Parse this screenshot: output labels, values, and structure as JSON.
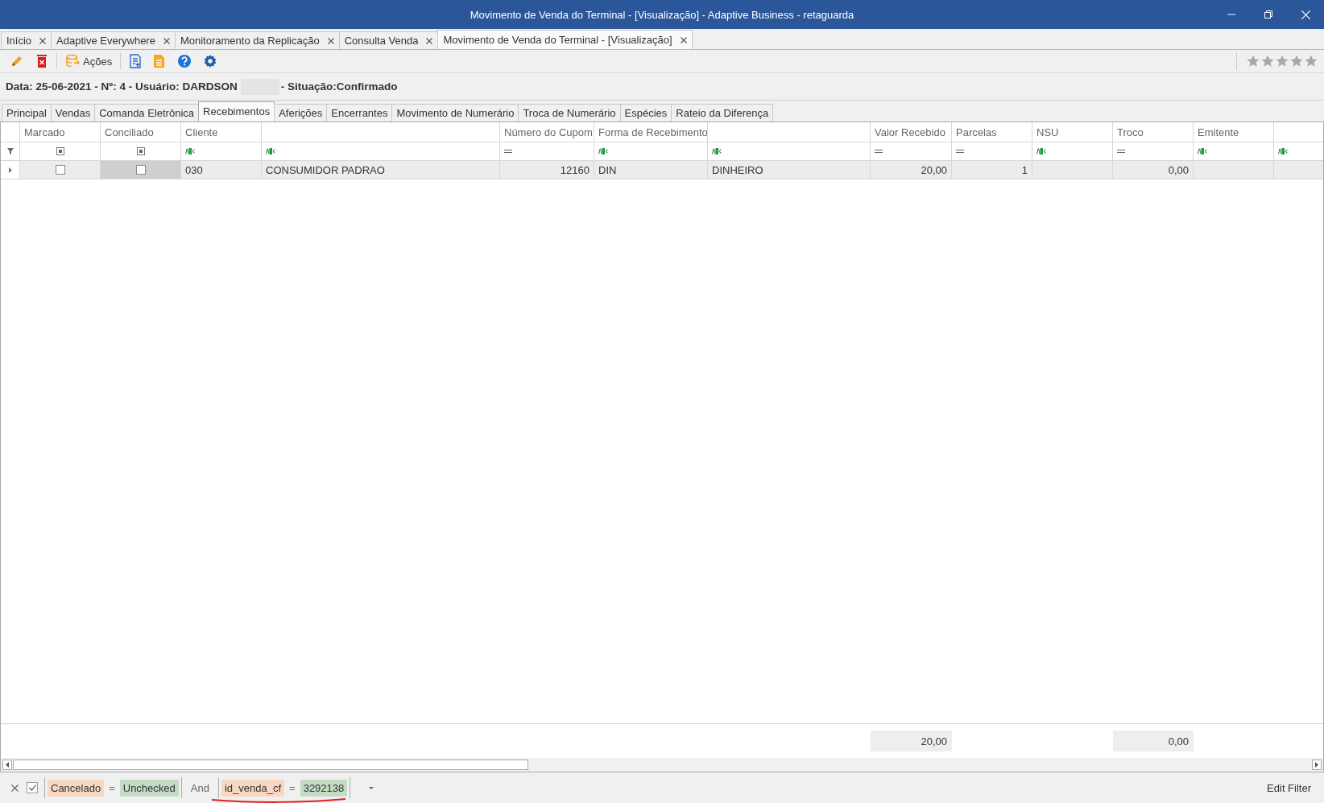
{
  "window": {
    "title": "Movimento de Venda do Terminal - [Visualização] - Adaptive Business - retaguarda"
  },
  "doc_tabs": [
    {
      "label": "Início",
      "selected": false
    },
    {
      "label": "Adaptive Everywhere",
      "selected": false
    },
    {
      "label": "Monitoramento da Replicação",
      "selected": false
    },
    {
      "label": "Consulta Venda",
      "selected": false
    },
    {
      "label": "Movimento de Venda do Terminal - [Visualização]",
      "selected": true
    }
  ],
  "toolbar": {
    "actions_label": "Ações",
    "rating": {
      "stars": 0
    }
  },
  "header": {
    "left": "Data: 25-06-2021 - Nº: 4 - Usuário: DARDSON",
    "right": "- Situação:Confirmado"
  },
  "sub_tabs": [
    {
      "label": "Principal",
      "selected": false
    },
    {
      "label": "Vendas",
      "selected": false
    },
    {
      "label": "Comanda Eletrônica",
      "selected": false
    },
    {
      "label": "Recebimentos",
      "selected": true
    },
    {
      "label": "Aferições",
      "selected": false
    },
    {
      "label": "Encerrantes",
      "selected": false
    },
    {
      "label": "Movimento de Numerário",
      "selected": false
    },
    {
      "label": "Troca de Numerário",
      "selected": false
    },
    {
      "label": "Espécies",
      "selected": false
    },
    {
      "label": "Rateio da Diferença",
      "selected": false
    }
  ],
  "grid": {
    "columns": [
      {
        "label": "Marcado",
        "kind": "check",
        "read_only": false
      },
      {
        "label": "Conciliado",
        "kind": "check",
        "read_only": true
      },
      {
        "label": "Cliente",
        "kind": "text",
        "read_only": false
      },
      {
        "kind": "text",
        "read_only": false
      },
      {
        "label": "Número do Cupom",
        "kind": "number",
        "read_only": false
      },
      {
        "label": "Forma de Recebimento",
        "kind": "text",
        "read_only": false
      },
      {
        "kind": "text",
        "read_only": false
      },
      {
        "label": "Valor Recebido",
        "kind": "number",
        "read_only": false,
        "total": "20,00"
      },
      {
        "label": "Parcelas",
        "kind": "number",
        "read_only": false
      },
      {
        "label": "NSU",
        "kind": "text",
        "read_only": false
      },
      {
        "label": "Troco",
        "kind": "number",
        "read_only": false,
        "total": "0,00"
      },
      {
        "label": "Emitente",
        "kind": "text",
        "read_only": false
      },
      {
        "kind": "text",
        "read_only": false
      }
    ],
    "rows": [
      {
        "selected": true,
        "cells": [
          {
            "checked": false
          },
          {
            "checked": false
          },
          {
            "text": "030"
          },
          {
            "text": "CONSUMIDOR PADRAO"
          },
          {
            "text": "12160"
          },
          {
            "text": "DIN"
          },
          {
            "text": "DINHEIRO"
          },
          {
            "text": "20,00"
          },
          {
            "text": "1"
          },
          {},
          {
            "text": "0,00"
          },
          {},
          {}
        ]
      }
    ]
  },
  "filter_bar": {
    "enabled": true,
    "conditions": [
      {
        "field": "Cancelado",
        "op": "=",
        "value": "Unchecked"
      },
      {
        "field": "id_venda_cf",
        "op": "=",
        "value": "3292138",
        "underlined": true
      }
    ],
    "joiner": "And",
    "edit_label": "Edit Filter"
  }
}
